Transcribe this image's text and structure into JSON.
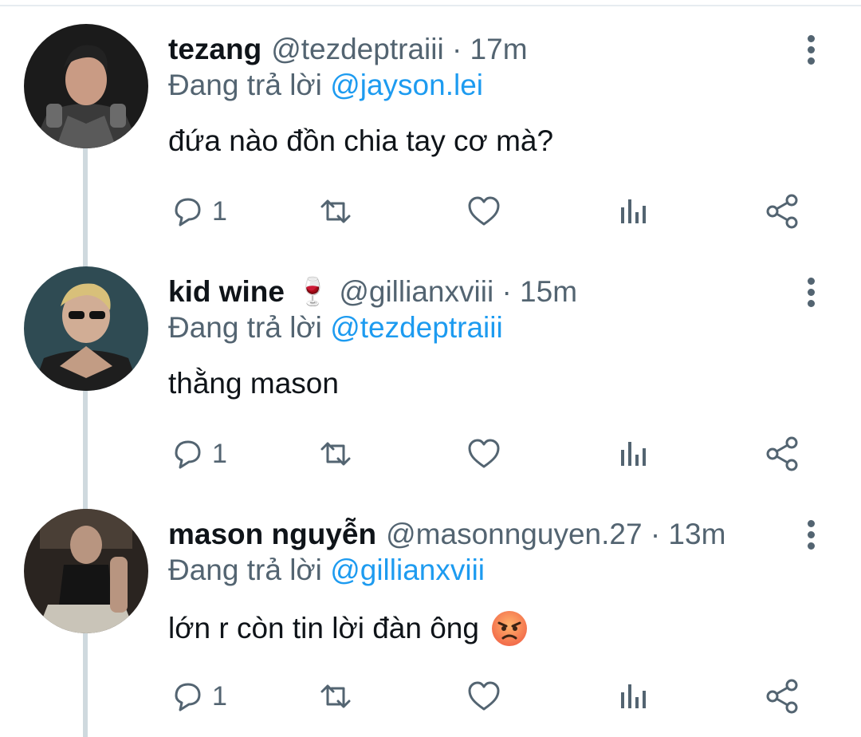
{
  "tweets": [
    {
      "name": "tezang",
      "handle": "@tezdeptraiii · 17m",
      "name_emoji": "",
      "replying_prefix": "Đang trả lời ",
      "replying_to": "@jayson.lei",
      "text": "đứa nào đồn chia tay cơ mà?",
      "text_emoji": "",
      "reply_count": "1"
    },
    {
      "name": "kid wine",
      "handle": "@gillianxviii · 15m",
      "name_emoji": "🍷",
      "replying_prefix": "Đang trả lời ",
      "replying_to": "@tezdeptraiii",
      "text": "thằng mason",
      "text_emoji": "",
      "reply_count": "1"
    },
    {
      "name": "mason nguyễn",
      "handle": "@masonnguyen.27 · 13m",
      "name_emoji": "",
      "replying_prefix": "Đang trả lời ",
      "replying_to": "@gillianxviii",
      "text": "lớn r còn tin lời đàn ông",
      "text_emoji": "angry-face",
      "reply_count": "1"
    }
  ],
  "colors": {
    "text": "#0f1419",
    "secondary": "#536471",
    "link": "#1d9bf0",
    "thread_line": "#cfd9de"
  }
}
